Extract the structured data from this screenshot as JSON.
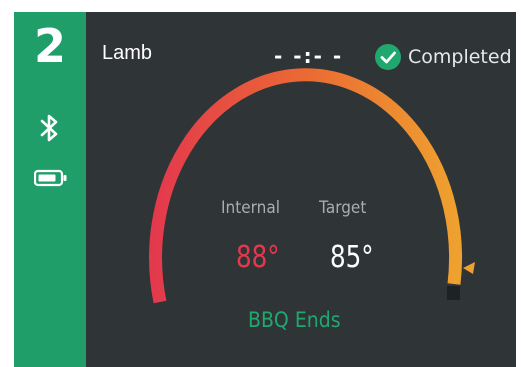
{
  "probe": {
    "number": "2",
    "bluetooth_icon": "bluetooth-icon",
    "battery_icon": "battery-icon"
  },
  "header": {
    "food": "Lamb",
    "timer": "- -:- -",
    "status_icon": "check-circle-icon",
    "status": "Completed"
  },
  "gauge": {
    "internal_label": "Internal",
    "target_label": "Target",
    "internal_value": "88°",
    "target_value": "85°",
    "footer": "BBQ Ends"
  },
  "colors": {
    "sidebar": "#1f9e6a",
    "panel": "#2f3437",
    "internal_temp": "#e3394d",
    "target_temp": "#ffffff",
    "arc_start": "#e3394d",
    "arc_end": "#eea12f",
    "accent_green": "#21a86e"
  }
}
